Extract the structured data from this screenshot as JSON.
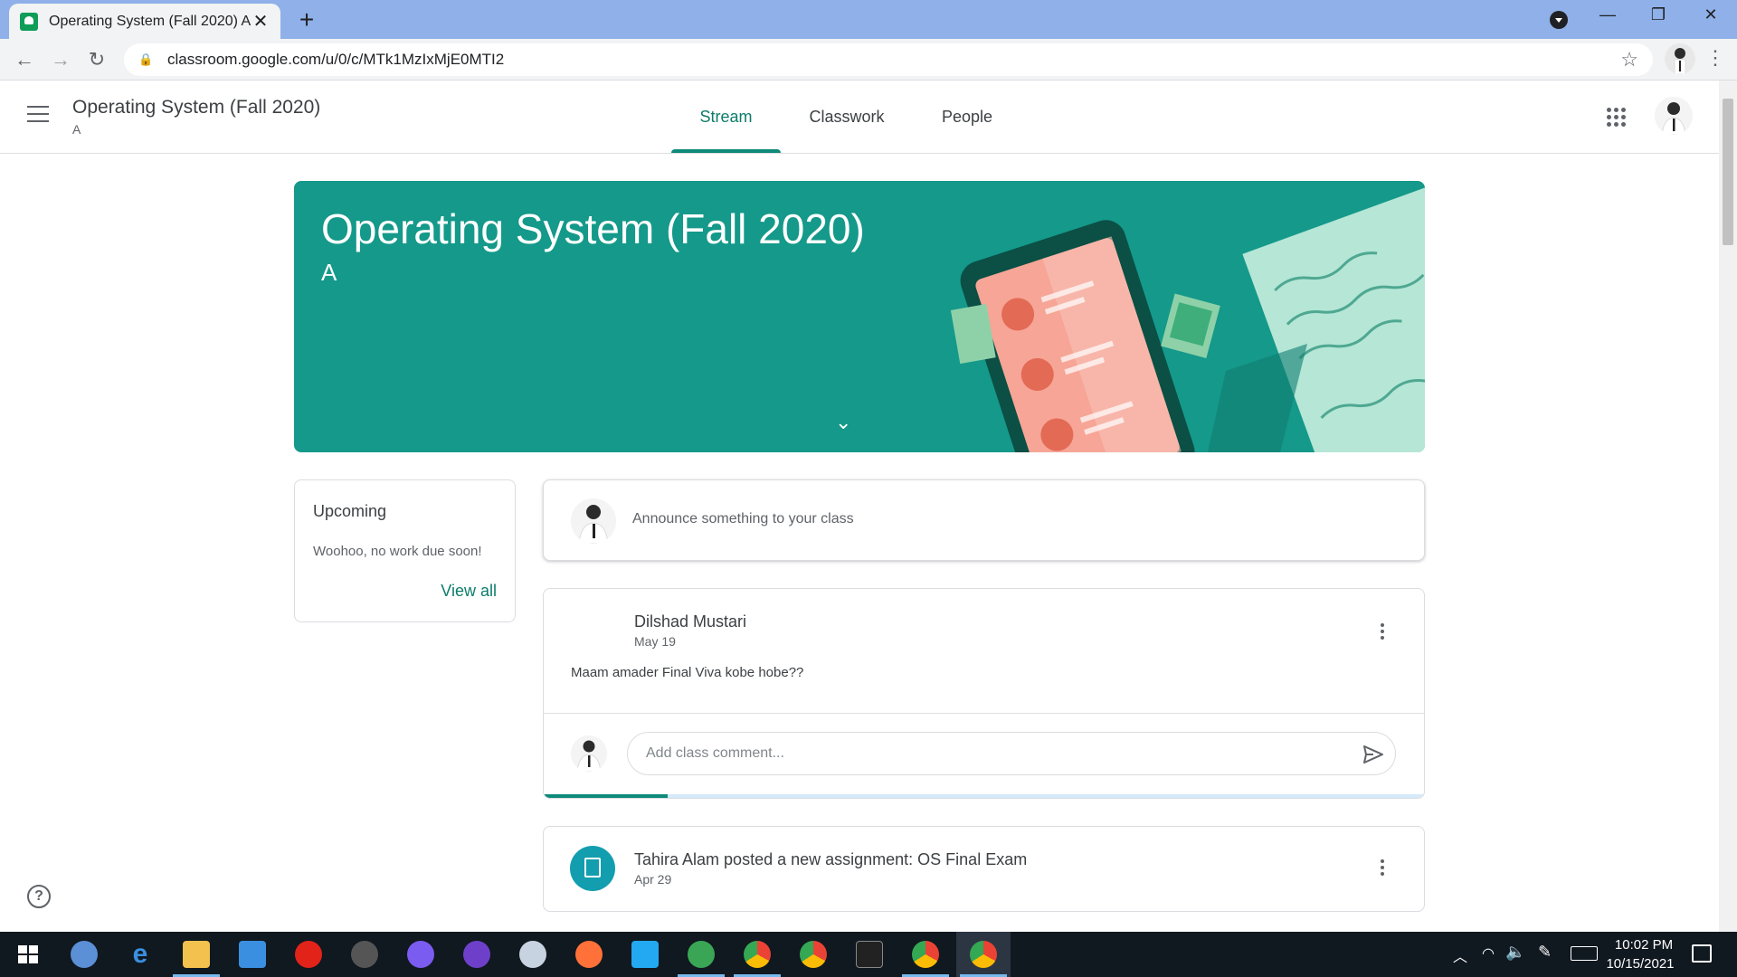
{
  "browser": {
    "tab_title": "Operating System (Fall 2020) A",
    "url": "classroom.google.com/u/0/c/MTk1MzIxMjE0MTI2"
  },
  "header": {
    "class_name": "Operating System (Fall 2020)",
    "section": "A",
    "tabs": [
      {
        "label": "Stream"
      },
      {
        "label": "Classwork"
      },
      {
        "label": "People"
      }
    ]
  },
  "banner": {
    "title": "Operating System (Fall 2020)",
    "section": "A"
  },
  "upcoming": {
    "heading": "Upcoming",
    "text": "Woohoo, no work due soon!",
    "view_all": "View all"
  },
  "announce": {
    "placeholder": "Announce something to your class"
  },
  "posts": [
    {
      "author": "Dilshad Mustari",
      "date": "May 19",
      "body": "Maam amader Final Viva kobe hobe??",
      "comment_placeholder": "Add class comment...",
      "upload_progress": 0.14
    },
    {
      "author": "Tahira Alam posted a new assignment: OS Final Exam",
      "date": "Apr 29"
    }
  ],
  "taskbar": {
    "time": "10:02 PM",
    "date": "10/15/2021"
  },
  "colors": {
    "accent": "#0d8a7a",
    "banner": "#14998a",
    "titlebar": "#8fb0e8",
    "taskbar": "#101820"
  }
}
